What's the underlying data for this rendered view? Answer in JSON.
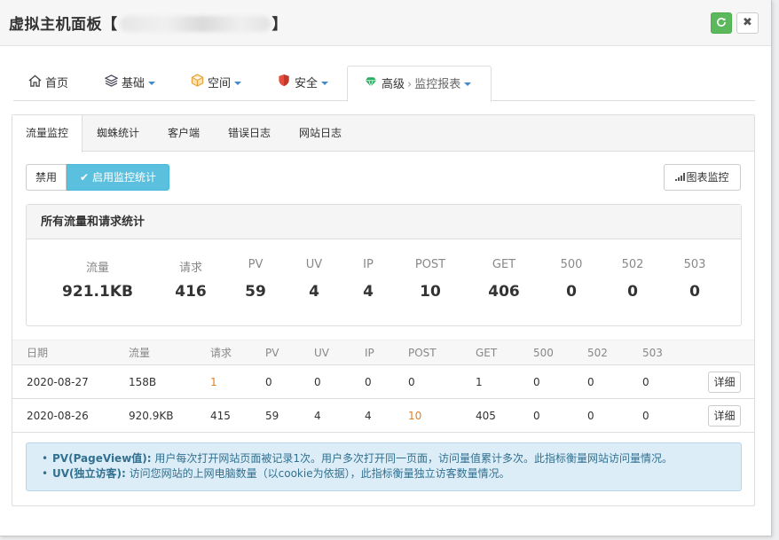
{
  "dialog": {
    "title": "虚拟主机面板",
    "title_bracket_open": "【",
    "title_bracket_close": "】",
    "refresh_icon": "refresh-icon",
    "close_label": "✖"
  },
  "nav": {
    "items": [
      {
        "label": "首页",
        "icon": "home-icon"
      },
      {
        "label": "基础",
        "icon": "layers-icon"
      },
      {
        "label": "空间",
        "icon": "box-icon"
      },
      {
        "label": "安全",
        "icon": "shield-icon"
      },
      {
        "label": "高级",
        "icon": "diamond-icon",
        "sub": "监控报表"
      }
    ],
    "separator": "›"
  },
  "subtabs": [
    "流量监控",
    "蜘蛛统计",
    "客户端",
    "错误日志",
    "网站日志"
  ],
  "toolbar": {
    "disable_label": "禁用",
    "enable_label": "启用监控统计",
    "chart_label": "图表监控"
  },
  "summary": {
    "title": "所有流量和请求统计",
    "stats": [
      {
        "label": "流量",
        "value": "921.1KB"
      },
      {
        "label": "请求",
        "value": "416"
      },
      {
        "label": "PV",
        "value": "59"
      },
      {
        "label": "UV",
        "value": "4"
      },
      {
        "label": "IP",
        "value": "4"
      },
      {
        "label": "POST",
        "value": "10"
      },
      {
        "label": "GET",
        "value": "406"
      },
      {
        "label": "500",
        "value": "0"
      },
      {
        "label": "502",
        "value": "0"
      },
      {
        "label": "503",
        "value": "0"
      }
    ]
  },
  "table": {
    "headers": [
      "日期",
      "流量",
      "请求",
      "PV",
      "UV",
      "IP",
      "POST",
      "GET",
      "500",
      "502",
      "503"
    ],
    "rows": [
      [
        "2020-08-27",
        "158B",
        "1",
        "0",
        "0",
        "0",
        "0",
        "1",
        "0",
        "0",
        "0"
      ],
      [
        "2020-08-26",
        "920.9KB",
        "415",
        "59",
        "4",
        "4",
        "10",
        "405",
        "0",
        "0",
        "0"
      ]
    ],
    "detail_label": "详细"
  },
  "notes": [
    {
      "term": "PV(PageView值):",
      "text": " 用户每次打开网站页面被记录1次。用户多次打开同一页面，访问量值累计多次。此指标衡量网站访问量情况。"
    },
    {
      "term": "UV(独立访客):",
      "text": " 访问您网站的上网电脑数量（以cookie为依据），此指标衡量独立访客数量情况。"
    }
  ],
  "colors": {
    "accent_info": "#5bc0de",
    "success": "#5cb85c",
    "highlight_orange": "#e67e22",
    "note_bg": "#dcedf8"
  }
}
